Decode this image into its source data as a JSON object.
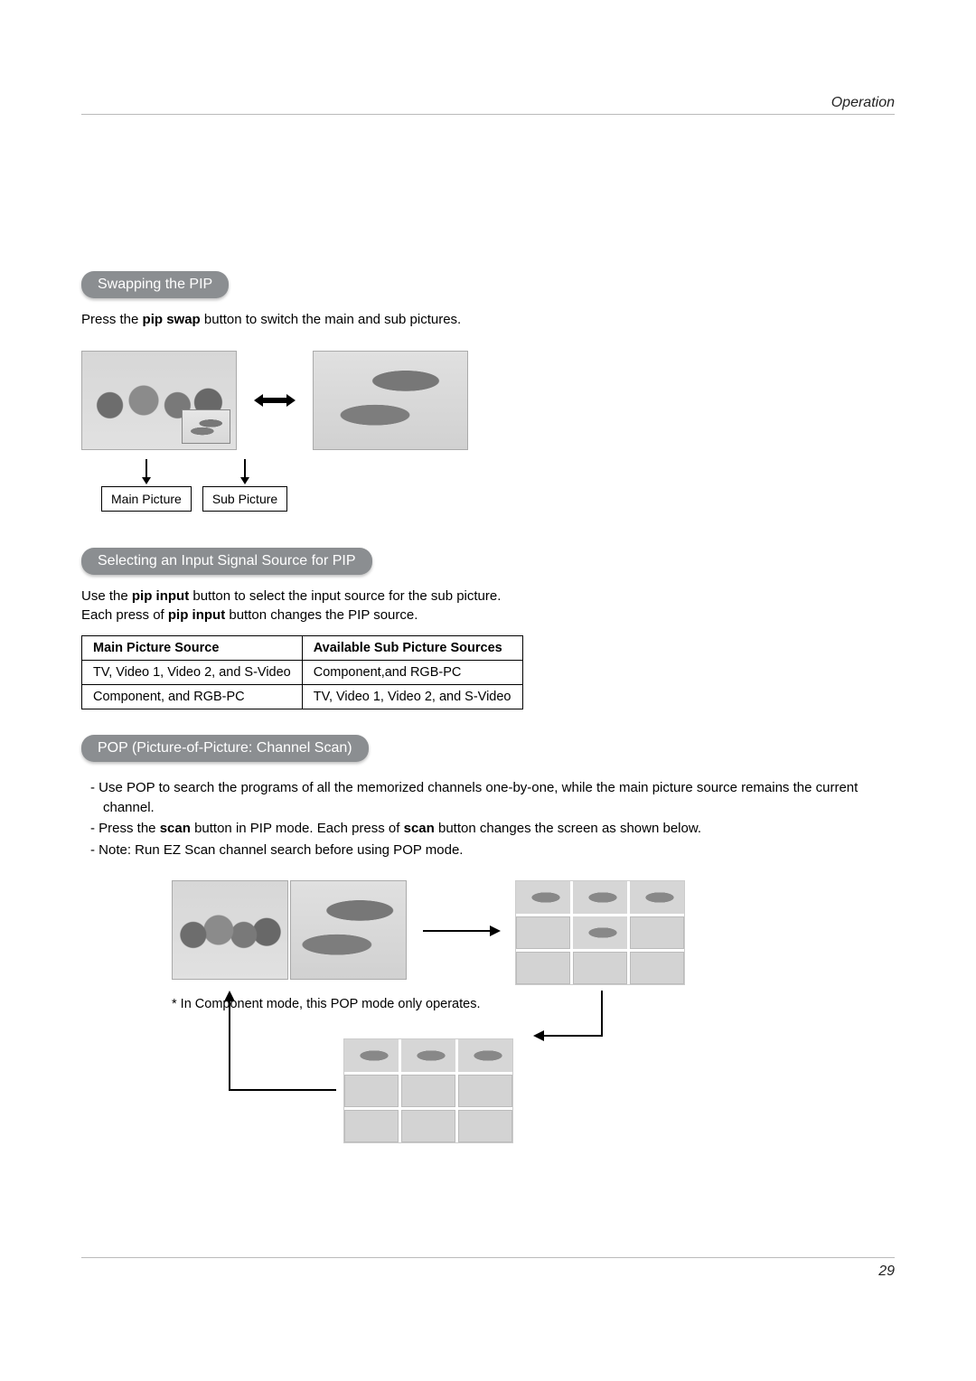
{
  "header": {
    "section": "Operation"
  },
  "footer": {
    "page": "29"
  },
  "sec1": {
    "title": "Swapping the PIP",
    "text_a": "Press the ",
    "text_b": "pip swap",
    "text_c": " button to switch the main and sub pictures.",
    "label_main": "Main Picture",
    "label_sub": "Sub Picture"
  },
  "sec2": {
    "title": "Selecting an Input Signal Source for PIP",
    "line1_a": "Use the ",
    "line1_b": "pip input",
    "line1_c": " button to select the input source for the sub picture.",
    "line2_a": "Each press of ",
    "line2_b": "pip input",
    "line2_c": " button changes the PIP source.",
    "table": {
      "h1": "Main Picture Source",
      "h2": "Available Sub Picture Sources",
      "r1c1": "TV, Video 1, Video 2, and S-Video",
      "r1c2": "Component,and RGB-PC",
      "r2c1": "Component, and RGB-PC",
      "r2c2": "TV, Video 1, Video 2, and S-Video"
    }
  },
  "sec3": {
    "title": "POP (Picture-of-Picture: Channel Scan)",
    "b1": "-   Use POP to search the programs of all the memorized channels one-by-one, while the main picture source remains the current channel.",
    "b2_a": "-   Press the ",
    "b2_b": "scan",
    "b2_c": " button in PIP mode. Each press of ",
    "b2_d": "scan",
    "b2_e": " button changes the screen as shown below.",
    "b3": "-   Note: Run EZ Scan channel search before using POP mode.",
    "note": "In Component mode, this POP mode only operates."
  }
}
